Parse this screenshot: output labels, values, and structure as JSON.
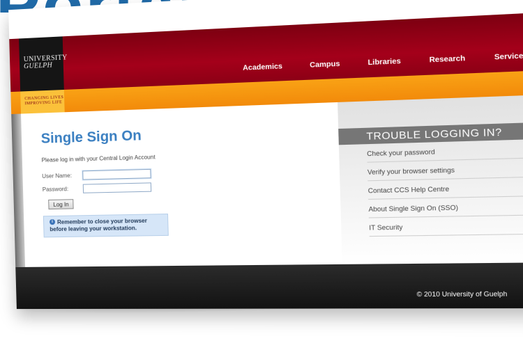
{
  "header_title": "Portal",
  "brand": {
    "logo_line1": "UNIVERSITY",
    "logo_line2": "GUELPH",
    "tagline_line1": "Changing Lives",
    "tagline_line2": "Improving Life"
  },
  "nav": {
    "academics": "Academics",
    "campus": "Campus",
    "libraries": "Libraries",
    "research": "Research",
    "services": "Services"
  },
  "login": {
    "title": "Single Sign On",
    "intro": "Please log in with your Central Login Account",
    "username_label": "User Name:",
    "password_label": "Password:",
    "username_value": "",
    "password_value": "",
    "button": "Log In",
    "notice": "Remember to close your browser before leaving your workstation."
  },
  "trouble": {
    "title": "TROUBLE LOGGING IN?",
    "links": [
      "Check your password",
      "Verify your browser settings",
      "Contact CCS Help Centre",
      "About Single Sign On (SSO)",
      "IT Security"
    ]
  },
  "footer": {
    "copyright": "© 2010 University of Guelph"
  },
  "colors": {
    "maroon": "#a4001a",
    "orange": "#f28a0a",
    "blue_title": "#3a7fc1",
    "notice_bg": "#d6e6f8"
  },
  "icons": {
    "info": "info-icon"
  }
}
